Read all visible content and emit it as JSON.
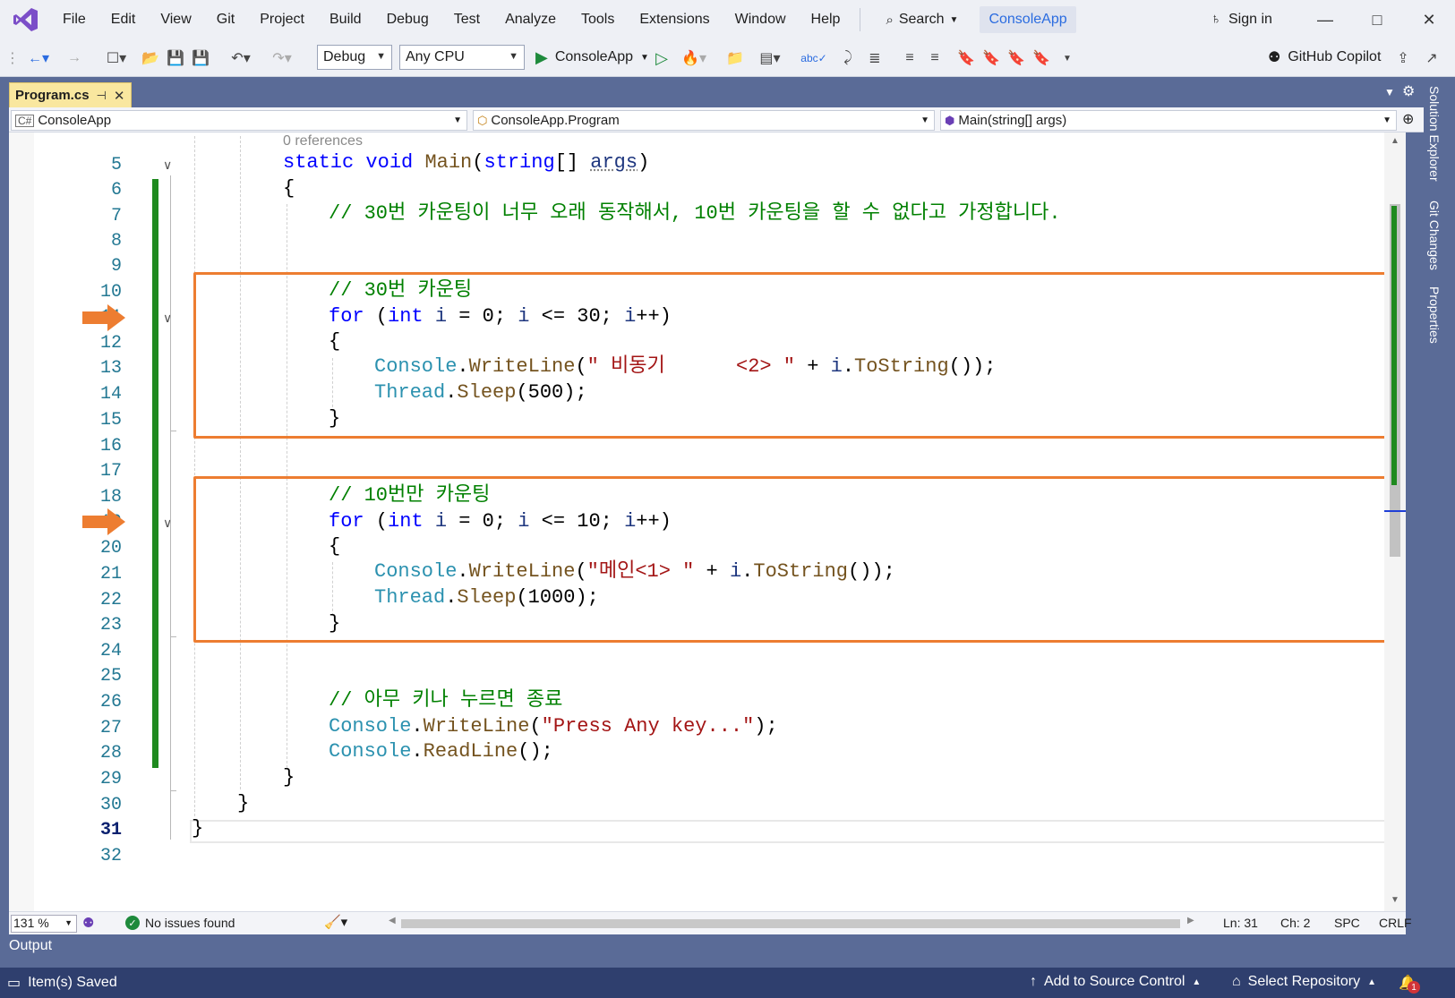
{
  "menu": {
    "items": [
      "File",
      "Edit",
      "View",
      "Git",
      "Project",
      "Build",
      "Debug",
      "Test",
      "Analyze",
      "Tools",
      "Extensions",
      "Window",
      "Help"
    ],
    "search_label": "Search",
    "solution_name": "ConsoleApp",
    "sign_in": "Sign in"
  },
  "toolbar": {
    "configuration": "Debug",
    "platform": "Any CPU",
    "run_target": "ConsoleApp",
    "copilot": "GitHub Copilot"
  },
  "tabs": {
    "active_file": "Program.cs"
  },
  "navbar": {
    "project": "ConsoleApp",
    "type": "ConsoleApp.Program",
    "member": "Main(string[] args)"
  },
  "code": {
    "references_hint": "0 references",
    "lines": [
      {
        "num": "5"
      },
      {
        "num": "6"
      },
      {
        "num": "7"
      },
      {
        "num": "8"
      },
      {
        "num": "9"
      },
      {
        "num": "10"
      },
      {
        "num": "11"
      },
      {
        "num": "12"
      },
      {
        "num": "13"
      },
      {
        "num": "14"
      },
      {
        "num": "15"
      },
      {
        "num": "16"
      },
      {
        "num": "17"
      },
      {
        "num": "18"
      },
      {
        "num": "19"
      },
      {
        "num": "20"
      },
      {
        "num": "21"
      },
      {
        "num": "22"
      },
      {
        "num": "23"
      },
      {
        "num": "24"
      },
      {
        "num": "25"
      },
      {
        "num": "26"
      },
      {
        "num": "27"
      },
      {
        "num": "28"
      },
      {
        "num": "29"
      },
      {
        "num": "30"
      },
      {
        "num": "31"
      },
      {
        "num": "32"
      }
    ],
    "comment_assume": "// 30번 카운팅이 너무 오래 동작해서, 10번 카운팅을 할 수 없다고 가정합니다.",
    "comment_30": "// 30번 카운팅",
    "loop_limit_30": "30",
    "string_async": "\" 비동기      <2> \"",
    "sleep_500": "500",
    "comment_10": "// 10번만 카운팅",
    "loop_limit_10": "10",
    "string_main": "\"메인<1> \"",
    "sleep_1000": "1000",
    "comment_exit": "// 아무 키나 누르면 종료",
    "string_press": "\"Press Any key...\""
  },
  "editor_status": {
    "zoom": "131 %",
    "issues": "No issues found",
    "line": "Ln: 31",
    "char": "Ch: 2",
    "whitespace": "SPC",
    "line_endings": "CRLF"
  },
  "panels": {
    "output": "Output",
    "side_tabs": [
      "Solution Explorer",
      "Git Changes",
      "Properties"
    ]
  },
  "statusbar": {
    "left_text": "Item(s) Saved",
    "source_control": "Add to Source Control",
    "select_repo": "Select Repository",
    "notifications_count": "1"
  },
  "colors": {
    "accent_orange": "#ed7d31",
    "change_bar_green": "#1f8a1f",
    "statusbar_bg": "#2f3f6e",
    "frame_bg": "#5a6b97"
  }
}
